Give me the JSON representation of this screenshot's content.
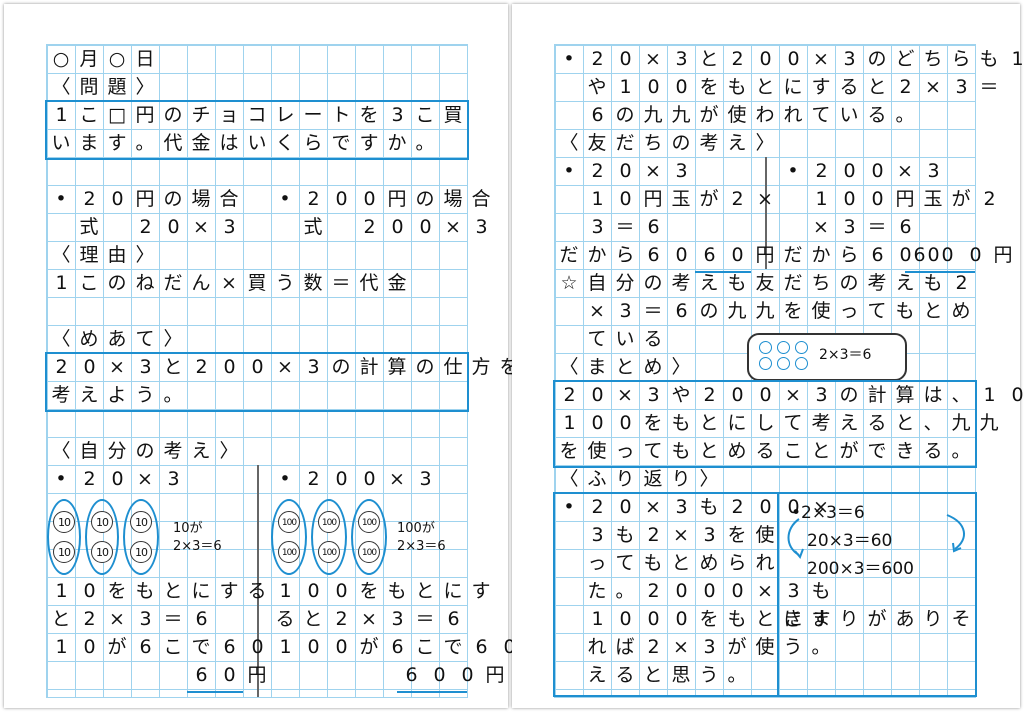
{
  "left": {
    "date": "○月○日",
    "problem_heading": "〈問題〉",
    "problem_line1": "1こ□円のチョコレートを3こ買",
    "problem_line2": "います。代金はいくらですか。",
    "case20_title": "•20円の場合",
    "case20_formula": "式　20×3",
    "case200_title": "•200円の場合",
    "case200_formula": "式　200×3",
    "reason_heading": "〈理由〉",
    "reason_text": "1このねだん×買う数＝代金",
    "goal_heading": "〈めあて〉",
    "goal_line1": "20×3と200×3の計算の仕方を",
    "goal_line2": "考えよう。",
    "own_heading": "〈自分の考え〉",
    "own_a_title": "•20×3",
    "own_a_coin": "10",
    "own_a_note1": "10が",
    "own_a_note2": "2×3＝6",
    "own_a_l1": "10をもとにする",
    "own_a_l2": "と2×3＝6",
    "own_a_l3": "10が6こで60",
    "own_a_ans": "60円",
    "own_b_title": "•200×3",
    "own_b_coin": "100",
    "own_b_note1": "100が",
    "own_b_note2": "2×3＝6",
    "own_b_l1": "100をもとにす",
    "own_b_l2": "ると2×3＝6",
    "own_b_l3": "100が6こで600",
    "own_b_ans": "600円"
  },
  "right": {
    "r1": "•20×3と200×3のどちらも10",
    "r2": "や100をもとにすると2×3＝",
    "r3": "6の九九が使われている。",
    "friend_heading": "〈友だちの考え〉",
    "fa_title": "•20×3",
    "fa_l1": "10円玉が2×",
    "fa_l2": "3＝6",
    "fa_l3": "だから60",
    "fa_ans": "60円",
    "fb_title": "•200×3",
    "fb_l1": "100円玉が2",
    "fb_l2": "×3＝6",
    "fb_l3": "だから600",
    "fb_ans": "600円",
    "star1": "☆自分の考えも友だちの考えも2",
    "star2": "×3＝6の九九を使ってもとめ",
    "star3": "ている",
    "bubble_text": "2×3＝6",
    "summary_heading": "〈まとめ〉",
    "sum1": "20×3や200×3の計算は、10や",
    "sum2": "100をもとにして考えると、九九",
    "sum3": "を使ってもとめることができる。",
    "reflect_heading": "〈ふり返り〉",
    "ref_l1": "•20×3も200×",
    "ref_l2": "3も2×3を使",
    "ref_l3": "ってもとめられ",
    "ref_l4": "た。2000×3も",
    "ref_l5": "1000をもとにす",
    "ref_l6": "れば2×3が使",
    "ref_l7": "えると思う。",
    "ref_r1": "•2×3＝6",
    "ref_r2": "20×3＝60",
    "ref_r3": "200×3＝600",
    "ref_r4": "きまりがありそ",
    "ref_r5": "う。"
  },
  "colors": {
    "grid": "#9fd3ee",
    "frame": "#1e8fd0"
  }
}
